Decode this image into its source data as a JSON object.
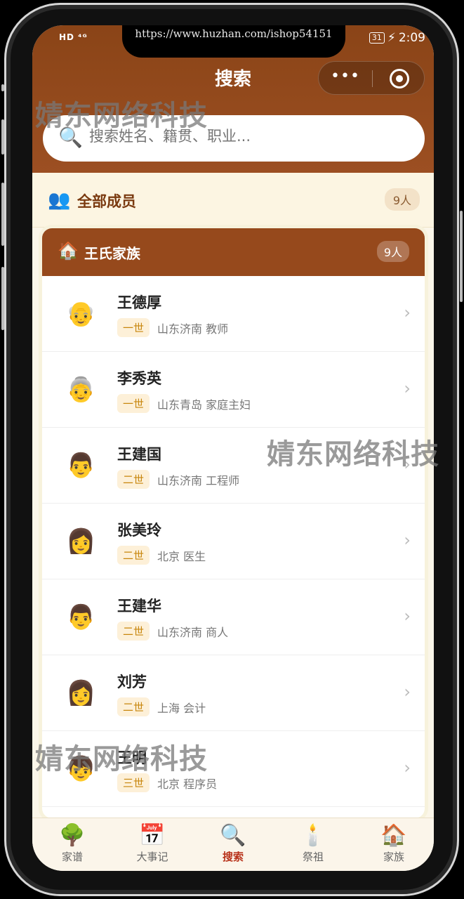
{
  "status": {
    "left": "HD ⁴ᴳ",
    "battery": "31",
    "time": "2:09"
  },
  "url_overlay": "https://www.huzhan.com/ishop54151",
  "header": {
    "title": "搜索",
    "more_icon": "•••"
  },
  "search": {
    "placeholder": "搜索姓名、籍贯、职业...",
    "icon": "🔍"
  },
  "all_members": {
    "label": "全部成员",
    "count": "9人",
    "icon": "👥"
  },
  "family": {
    "label": "王氏家族",
    "count": "9人",
    "icon": "🏠"
  },
  "members": [
    {
      "avatar": "👴",
      "name": "王德厚",
      "generation": "一世",
      "info": "山东济南 教师"
    },
    {
      "avatar": "👵",
      "name": "李秀英",
      "generation": "一世",
      "info": "山东青岛 家庭主妇"
    },
    {
      "avatar": "👨",
      "name": "王建国",
      "generation": "二世",
      "info": "山东济南 工程师"
    },
    {
      "avatar": "👩",
      "name": "张美玲",
      "generation": "二世",
      "info": "北京 医生"
    },
    {
      "avatar": "👨",
      "name": "王建华",
      "generation": "二世",
      "info": "山东济南 商人"
    },
    {
      "avatar": "👩",
      "name": "刘芳",
      "generation": "二世",
      "info": "上海 会计"
    },
    {
      "avatar": "👦",
      "name": "王明",
      "generation": "三世",
      "info": "北京 程序员"
    }
  ],
  "chevron": "›",
  "tabs": [
    {
      "icon": "🌳",
      "label": "家谱"
    },
    {
      "icon": "📅",
      "label": "大事记"
    },
    {
      "icon": "🔍",
      "label": "搜索"
    },
    {
      "icon": "🕯️",
      "label": "祭祖"
    },
    {
      "icon": "🏠",
      "label": "家族"
    }
  ],
  "watermark": "婧东网络科技"
}
